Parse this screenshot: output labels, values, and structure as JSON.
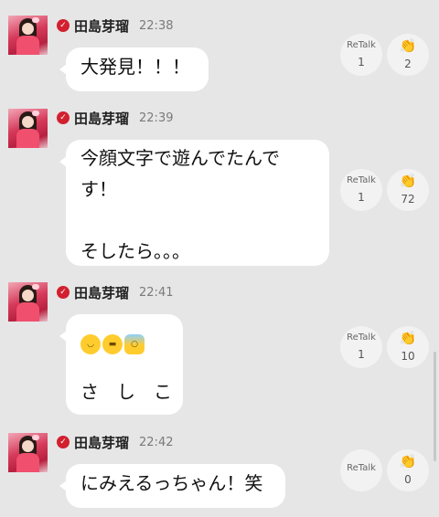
{
  "messages": [
    {
      "user": "田島芽瑠",
      "time": "22:38",
      "lines": [
        "大発見！！！"
      ],
      "retalk_label": "ReTalk",
      "retalk_count": "1",
      "clap_count": "2"
    },
    {
      "user": "田島芽瑠",
      "time": "22:39",
      "lines": [
        "今顔文字で遊んでたんで",
        "す！",
        "",
        "そしたら。。。"
      ],
      "retalk_label": "ReTalk",
      "retalk_count": "1",
      "clap_count": "72"
    },
    {
      "user": "田島芽瑠",
      "time": "22:41",
      "emojis": [
        "smiling-face-emoji",
        "grinning-face-emoji",
        "screaming-face-emoji"
      ],
      "lines": [
        "さ　し　こ"
      ],
      "retalk_label": "ReTalk",
      "retalk_count": "1",
      "clap_count": "10"
    },
    {
      "user": "田島芽瑠",
      "time": "22:42",
      "lines": [
        "にみえるっちゃん！笑"
      ],
      "retalk_label": "ReTalk",
      "retalk_count": "",
      "clap_count": "0"
    }
  ],
  "icons": {
    "verified": "check-badge-icon",
    "clap": "clapping-hands-icon"
  },
  "colors": {
    "background": "#e6e6e6",
    "bubble": "#ffffff",
    "verified_badge": "#d2202f"
  }
}
